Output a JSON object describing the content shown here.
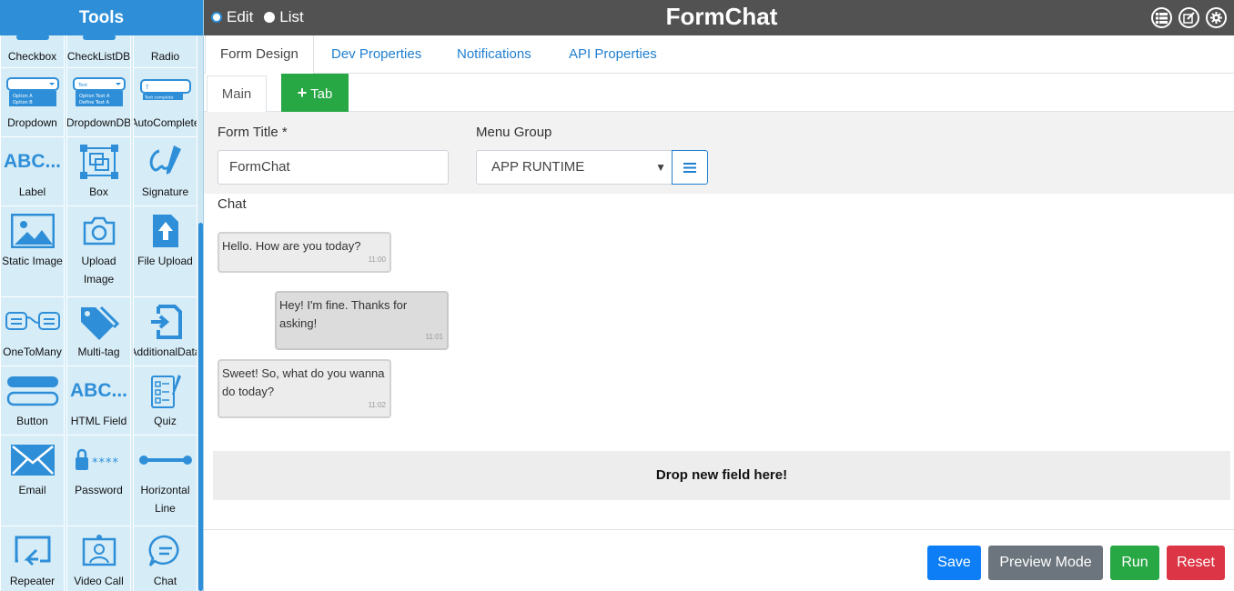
{
  "sidebar": {
    "title": "Tools",
    "rows": [
      [
        {
          "label": "Checkbox",
          "icon": "checkbox-icon"
        },
        {
          "label": "CheckListDB",
          "icon": "checklist-db-icon"
        },
        {
          "label": "Radio",
          "icon": "radio-icon"
        }
      ],
      [
        {
          "label": "Dropdown",
          "icon": "dropdown-icon",
          "preview": [
            "Option A",
            "Option B"
          ]
        },
        {
          "label": "DropdownDB",
          "icon": "dropdown-db-icon",
          "preview": [
            "Text",
            "Option Text A",
            "Define Text A"
          ]
        },
        {
          "label": "AutoComplete",
          "icon": "autocomplete-icon",
          "preview": [
            "T",
            "Text complete"
          ]
        }
      ],
      [
        {
          "label": "Label",
          "icon": "label-icon",
          "glyph": "ABC..."
        },
        {
          "label": "Box",
          "icon": "box-icon"
        },
        {
          "label": "Signature",
          "icon": "signature-icon"
        }
      ],
      [
        {
          "label": "Static Image",
          "icon": "image-icon"
        },
        {
          "label": "Upload",
          "label2": "Image",
          "icon": "camera-icon"
        },
        {
          "label": "File Upload",
          "icon": "file-upload-icon"
        }
      ],
      [
        {
          "label": "OneToMany",
          "icon": "one-to-many-icon"
        },
        {
          "label": "Multi-tag",
          "icon": "tags-icon"
        },
        {
          "label": "AdditionalData",
          "icon": "additional-data-icon"
        }
      ],
      [
        {
          "label": "Button",
          "icon": "button-icon"
        },
        {
          "label": "HTML Field",
          "icon": "html-field-icon",
          "glyph": "ABC..."
        },
        {
          "label": "Quiz",
          "icon": "quiz-icon"
        }
      ],
      [
        {
          "label": "Email",
          "icon": "email-icon"
        },
        {
          "label": "Password",
          "icon": "password-icon",
          "glyph": "****"
        },
        {
          "label": "Horizontal",
          "label2": "Line",
          "icon": "horizontal-line-icon"
        }
      ],
      [
        {
          "label": "Repeater",
          "icon": "repeater-icon"
        },
        {
          "label": "Video Call",
          "icon": "video-call-icon"
        },
        {
          "label": "Chat",
          "icon": "chat-icon"
        }
      ]
    ]
  },
  "topbar": {
    "mode_edit": "Edit",
    "mode_list": "List",
    "title": "FormChat"
  },
  "tabs": [
    "Form Design",
    "Dev Properties",
    "Notifications",
    "API Properties"
  ],
  "subtabs": {
    "main": "Main",
    "add": "Tab"
  },
  "form": {
    "title_label": "Form Title *",
    "title_value": "FormChat",
    "menu_label": "Menu Group",
    "menu_value": "APP RUNTIME"
  },
  "chat": {
    "label": "Chat",
    "messages": [
      {
        "text": "Hello. How are you today?",
        "time": "11:00"
      },
      {
        "text": "Hey! I'm fine. Thanks for asking!",
        "time": "11:01"
      },
      {
        "text": "Sweet! So, what do you wanna do today?",
        "time": "11:02"
      }
    ]
  },
  "drop_zone": "Drop new field here!",
  "footer": {
    "save": "Save",
    "preview": "Preview Mode",
    "run": "Run",
    "reset": "Reset"
  },
  "colors": {
    "accent": "#2e8fd8",
    "topbar": "#525252",
    "save": "#0d7ef5",
    "preview": "#6c757d",
    "run": "#28a745",
    "reset": "#dc3545"
  }
}
